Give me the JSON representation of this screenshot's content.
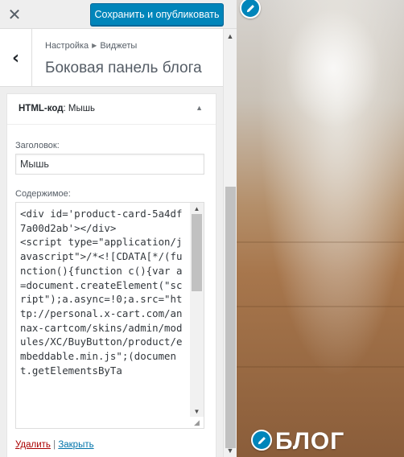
{
  "topbar": {
    "close_icon": "close-icon",
    "publish_label": "Сохранить и опубликовать"
  },
  "panel": {
    "breadcrumb_root": "Настройка",
    "breadcrumb_current": "Виджеты",
    "title": "Боковая панель блога"
  },
  "widget": {
    "title": "HTML-код",
    "title_suffix": ": Мышь",
    "title_label": "Заголовок:",
    "title_value": "Мышь",
    "content_label": "Содержимое:",
    "content_value": "<div id='product-card-5a4df7a00d2ab'></div>\n<script type=\"application/javascript\">/*<![CDATA[*/(function(){function c(){var a=document.createElement(\"script\");a.async=!0;a.src=\"http://personal.x-cart.com/annax-cartcom/skins/admin/modules/XC/BuyButton/product/embeddable.min.js\";(document.getElementsByTa",
    "delete_label": "Удалить",
    "separator": "|",
    "close_label": "Закрыть"
  },
  "preview": {
    "blog_title": "БЛОГ"
  },
  "colors": {
    "accent": "#0085ba",
    "link": "#0073aa",
    "delete": "#aa0000"
  }
}
